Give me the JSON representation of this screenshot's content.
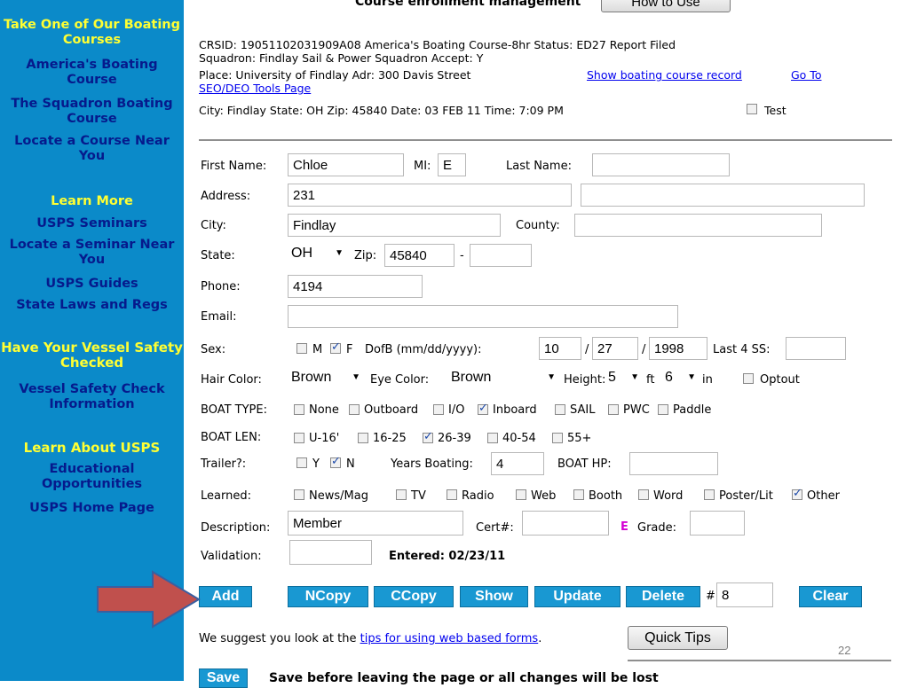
{
  "sidebar": {
    "take_one": "Take One of Our Boating Courses",
    "americas_course": "America's Boating Course",
    "squadron_course": "The Squadron Boating Course",
    "locate_course": "Locate a Course Near You",
    "learn_more": "Learn More",
    "seminars": "USPS Seminars",
    "locate_seminar": "Locate a Seminar Near You",
    "guides": "USPS Guides",
    "state_laws": "State Laws and Regs",
    "vessel_checked": "Have Your Vessel Safety Checked",
    "vessel_info": "Vessel Safety Check Information",
    "learn_about": "Learn About USPS",
    "educational": "Educational Opportunities",
    "home": "USPS Home Page"
  },
  "header": {
    "title": "Course enrollment management",
    "how_to_use": "How to Use"
  },
  "info": {
    "line1": "CRSID: 19051102031909A08   America's Boating Course-8hr   Status: ED27 Report Filed",
    "line2": "Squadron: Findlay Sail & Power Squadron      Accept: Y",
    "line3": "Place: University of Findlay   Adr: 300 Davis Street",
    "show_record": "Show boating course record",
    "goto_prefix": "Go To",
    "goto_rest": "SEO/DEO Tools Page",
    "line4": "City: Findlay   State: OH   Zip: 45840    Date: 03 FEB 11   Time: 7:09 PM",
    "test": "Test"
  },
  "labels": {
    "first_name": "First Name:",
    "mi": "MI:",
    "last_name": "Last Name:",
    "address": "Address:",
    "city": "City:",
    "county": "County:",
    "state": "State:",
    "zip": "Zip:",
    "dash": "-",
    "phone": "Phone:",
    "email": "Email:",
    "sex": "Sex:",
    "m": "M",
    "f": "F",
    "dob": "DofB (mm/dd/yyyy):",
    "slash": "/",
    "last4": "Last 4 SS:",
    "hair": "Hair Color:",
    "eye": "Eye Color:",
    "height": "Height:",
    "ft": "ft",
    "in": "in",
    "optout": "Optout",
    "boat_type": "BOAT TYPE:",
    "boat_len": "BOAT LEN:",
    "trailer": "Trailer?:",
    "y": "Y",
    "n": "N",
    "years_boating": "Years Boating:",
    "boat_hp": "BOAT HP:",
    "learned": "Learned:",
    "description": "Description:",
    "cert": "Cert#:",
    "e": "E",
    "grade": "Grade:",
    "validation": "Validation:",
    "entered": "Entered: 02/23/11",
    "hash": "#"
  },
  "values": {
    "first_name": "Chloe",
    "mi": "E",
    "last_name": "",
    "address": "231",
    "city": "Findlay",
    "state": "OH",
    "zip": "45840",
    "phone": "4194",
    "dob_mm": "10",
    "dob_dd": "27",
    "dob_yyyy": "1998",
    "hair": "Brown",
    "eye": "Brown",
    "height_ft": "5",
    "height_in": "6",
    "years_boating": "4",
    "description": "Member",
    "count": "8"
  },
  "boat_types": [
    "None",
    "Outboard",
    "I/O",
    "Inboard",
    "SAIL",
    "PWC",
    "Paddle"
  ],
  "boat_lens": [
    "U-16'",
    "16-25",
    "26-39",
    "40-54",
    "55+"
  ],
  "learned_opts": [
    "News/Mag",
    "TV",
    "Radio",
    "Web",
    "Booth",
    "Word",
    "Poster/Lit",
    "Other"
  ],
  "buttons": {
    "add": "Add",
    "ncopy": "NCopy",
    "ccopy": "CCopy",
    "show": "Show",
    "update": "Update",
    "delete": "Delete",
    "clear": "Clear",
    "quick_tips": "Quick Tips",
    "save": "Save"
  },
  "footer": {
    "suggest_prefix": "We suggest you look at the",
    "tips_link": "tips for using web based forms",
    "period": ".",
    "page_number": "22",
    "save_warning": "Save before leaving the page or all changes will be lost"
  },
  "colors": {
    "sidebar_bg": "#0b8ac9",
    "sidebar_heading": "#ffff33",
    "sidebar_link": "#061a8c",
    "button_blue": "#1998d2",
    "arrow_red": "#c0504d",
    "grade_e": "#d400d4"
  }
}
